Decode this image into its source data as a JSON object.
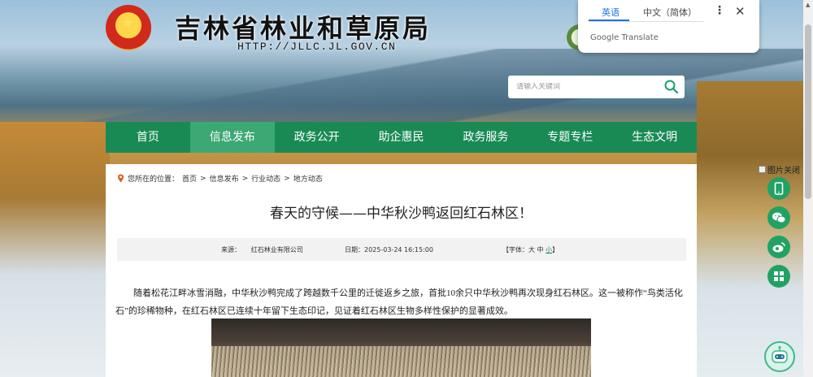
{
  "header": {
    "site_title": "吉林省林业和草原局",
    "site_url": "HTTP://JLLC.JL.GOV.CN"
  },
  "search": {
    "placeholder": "请输入关键词"
  },
  "nav": {
    "items": [
      {
        "label": "首页"
      },
      {
        "label": "信息发布"
      },
      {
        "label": "政务公开"
      },
      {
        "label": "助企惠民"
      },
      {
        "label": "政务服务"
      },
      {
        "label": "专题专栏"
      },
      {
        "label": "生态文明"
      }
    ],
    "active_index": 1
  },
  "breadcrumb": {
    "prefix": "您所在的位置：",
    "items": [
      "首页",
      "信息发布",
      "行业动态",
      "地方动态"
    ],
    "separator": ">"
  },
  "article": {
    "title": "春天的守候——中华秋沙鸭返回红石林区！",
    "source_label": "来源：",
    "source": "红石林业有限公司",
    "date_label": "日期：",
    "date": "2025-03-24 16:15:00",
    "font_label": "【字体：",
    "font_large": "大",
    "font_medium": "中",
    "font_small": "小",
    "font_close": "】",
    "body": "随着松花江畔冰雪消融，中华秋沙鸭完成了跨越数千公里的迁徙返乡之旅，首批10余只中华秋沙鸭再次现身红石林区。这一被称作“鸟类活化石”的珍稀物种，在红石林区已连续十年留下生态印记，见证着红石林区生物多样性保护的显著成效。"
  },
  "translate_popup": {
    "tab_en": "英语",
    "tab_zh": "中文（简体）",
    "brand": "Google Translate"
  },
  "side": {
    "close_label": "图片关闭"
  },
  "colors": {
    "nav_green": "#1a8a55",
    "nav_active": "#3ca874",
    "share_green": "#20a264",
    "translate_blue": "#1a73e8"
  }
}
